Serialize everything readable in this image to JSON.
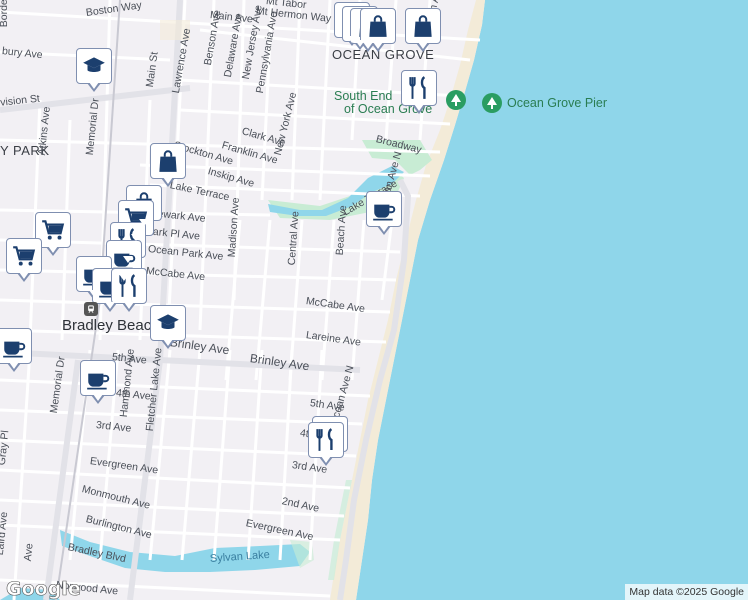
{
  "labels": {
    "boston_way": "Boston Way",
    "borden": "Borden",
    "main_ave_n": "Main Ave",
    "mt_hermon_way": "Mt Hermon Way",
    "mt_tabor": "Mt Tabor",
    "ocean_grove": "OCEAN GROVE",
    "bury_ave": "bury Ave",
    "main_st": "Main St",
    "lawrence_ave": "Lawrence Ave",
    "benson_ave": "Benson Ave",
    "delaware_ave": "Delaware Ave",
    "new_jersey_ave": "New Jersey Ave",
    "pennsylvania_ave": "Pennsylvania Ave",
    "ocean_ave_n_top": "Ocean Ave N",
    "ivision_st": "ivision St",
    "south_end_1": "South End",
    "south_end_2": "of Ocean Grove",
    "ocean_grove_pier": "Ocean Grove Pier",
    "y_park": "Y PARK",
    "atkins_ave": "Atkins Ave",
    "memorial_dr_top": "Memorial Dr",
    "clark_ave": "Clark Ave",
    "new_york_ave": "New York Ave",
    "franklin_ave": "Franklin Ave",
    "stockton_ave": "Stockton Ave",
    "broadway": "Broadway",
    "inskip_ave": "Inskip Ave",
    "lake_terrace_w": "Lake Terrace",
    "lake_terrace_e": "Lake Terrace",
    "newark_ave": "Newark Ave",
    "park_pl_ave": "Park Pl Ave",
    "ocean_ave_n_mid": "Ocean Ave N",
    "madison_ave": "Madison Ave",
    "central_ave": "Central Ave",
    "beach_ave": "Beach Ave",
    "ocean_park_ave": "Ocean Park Ave",
    "mccabe_w": "McCabe Ave",
    "mccabe_e": "McCabe Ave",
    "bradley_beach": "Bradley Beach",
    "lareine_ave": "Lareine Ave",
    "brinley_w": "Brinley Ave",
    "brinley_e": "Brinley Ave",
    "fifth_ave_w": "5th Ave",
    "fifth_ave_e": "5th Ave",
    "memorial_dr_bottom": "Memorial Dr",
    "hammond_ave": "Hammond Ave",
    "fletcher_lake_ave": "Fletcher Lake Ave",
    "fourth_ave_w": "4th Ave",
    "fourth_ave_e": "4th Ave",
    "ocean_ave_n_bottom": "Ocean Ave N",
    "third_ave_w": "3rd Ave",
    "third_ave_e": "3rd Ave",
    "gray_pl": "Gray Pl",
    "evergreen_ave_w": "Evergreen Ave",
    "evergreen_ave_e": "Evergreen Ave",
    "monmouth_ave": "Monmouth Ave",
    "second_ave": "2nd Ave",
    "burlington_ave": "Burlington Ave",
    "bradley_blvd": "Bradley Blvd",
    "sylvan_lake": "Sylvan Lake",
    "laird_ave": "Laird Ave",
    "norwood_ave": "Norwood Ave",
    "ave_left": "Ave"
  },
  "poi_icons": {
    "shopping": "shopping-bag-icon",
    "restaurant": "fork-knife-icon",
    "cafe": "coffee-cup-icon",
    "school": "graduation-cap-icon",
    "grocery": "shopping-cart-icon",
    "transit": "train-icon",
    "park": "tree-icon"
  },
  "colors": {
    "land": "#f2f0f4",
    "water": "#8fd6ea",
    "beach": "#f3ebd8",
    "park": "#c8ecd4",
    "road": "#ffffff",
    "major_road": "#e2e2e8",
    "pin_icon": "#1c3f6e",
    "park_pin": "#2a9d62"
  },
  "footer": {
    "logo": "Google",
    "attribution": "Map data ©2025 Google"
  }
}
